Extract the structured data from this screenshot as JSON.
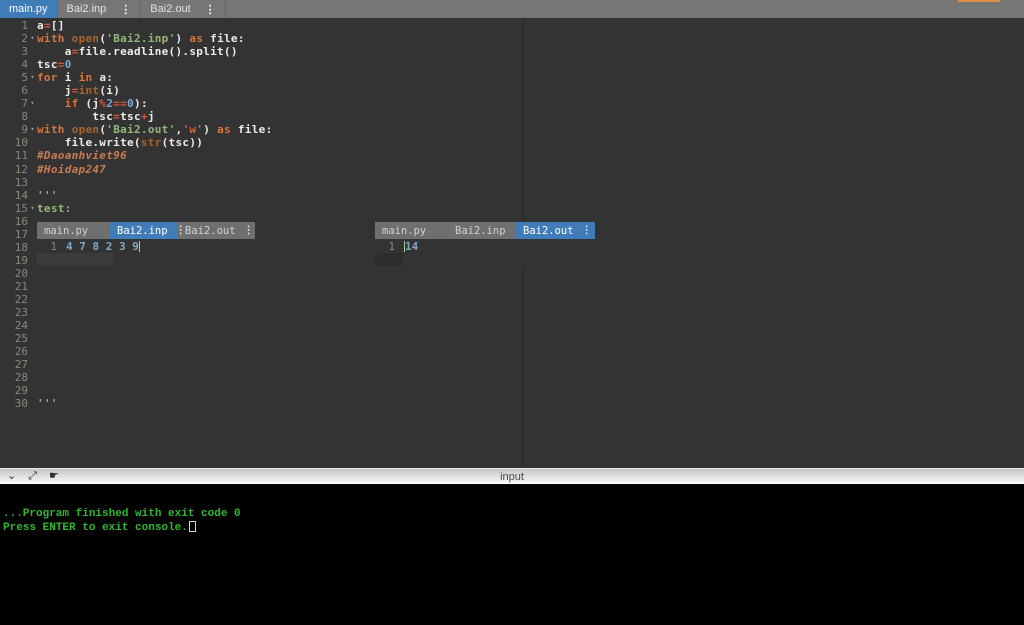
{
  "colors": {
    "tab_bar": "#767676",
    "active_tab": "#3f7cb8",
    "editor_bg": "#333333",
    "keyword": "#d9753c",
    "builtin": "#a8652f",
    "string": "#94b87c",
    "char_string": "#cc6644",
    "operator": "#d4553e",
    "number": "#7fa8c9",
    "comment": "#c87c50",
    "console_text": "#2fb92f"
  },
  "icons": {
    "menu_dots": "⋮",
    "collapse": "⌄",
    "resize": "⤢",
    "pointer": "☛",
    "fold_marker": "▾"
  },
  "top_tabs": [
    {
      "label": "main.py",
      "active": true
    },
    {
      "label": "Bai2.inp",
      "active": false
    },
    {
      "label": "Bai2.out",
      "active": false
    }
  ],
  "editor": {
    "fold_lines": [
      2,
      5,
      7,
      9,
      15
    ],
    "lines": [
      [
        [
          "a",
          "t"
        ],
        [
          "=",
          "o"
        ],
        [
          "[]",
          "t"
        ]
      ],
      [
        [
          "with",
          "k"
        ],
        [
          " ",
          "t"
        ],
        [
          "open",
          "f"
        ],
        [
          "(",
          "t"
        ],
        [
          "'Bai2.inp'",
          "s"
        ],
        [
          ") ",
          "t"
        ],
        [
          "as",
          "k"
        ],
        [
          " file:",
          "t"
        ]
      ],
      [
        [
          "    a",
          "t"
        ],
        [
          "=",
          "o"
        ],
        [
          "file.readline().split()",
          "t"
        ]
      ],
      [
        [
          "tsc",
          "t"
        ],
        [
          "=",
          "o"
        ],
        [
          "0",
          "n"
        ]
      ],
      [
        [
          "for",
          "k"
        ],
        [
          " i ",
          "t"
        ],
        [
          "in",
          "k"
        ],
        [
          " a:",
          "t"
        ]
      ],
      [
        [
          "    j",
          "t"
        ],
        [
          "=",
          "o"
        ],
        [
          "int",
          "f"
        ],
        [
          "(i)",
          "t"
        ]
      ],
      [
        [
          "    ",
          "t"
        ],
        [
          "if",
          "k"
        ],
        [
          " (j",
          "t"
        ],
        [
          "%",
          "o"
        ],
        [
          "2",
          "n"
        ],
        [
          "==",
          "o"
        ],
        [
          "0",
          "n"
        ],
        [
          "):",
          "t"
        ]
      ],
      [
        [
          "        tsc",
          "t"
        ],
        [
          "=",
          "o"
        ],
        [
          "tsc",
          "t"
        ],
        [
          "+",
          "o"
        ],
        [
          "j",
          "t"
        ]
      ],
      [
        [
          "with",
          "k"
        ],
        [
          " ",
          "t"
        ],
        [
          "open",
          "f"
        ],
        [
          "(",
          "t"
        ],
        [
          "'Bai2.out'",
          "s"
        ],
        [
          ",",
          "t"
        ],
        [
          "'w'",
          "w"
        ],
        [
          ") ",
          "t"
        ],
        [
          "as",
          "k"
        ],
        [
          " file:",
          "t"
        ]
      ],
      [
        [
          "    file.write(",
          "t"
        ],
        [
          "str",
          "f"
        ],
        [
          "(tsc))",
          "t"
        ]
      ],
      [
        [
          "#Daoanhviet96",
          "c"
        ]
      ],
      [
        [
          "#Hoidap247",
          "c"
        ]
      ],
      [],
      [
        [
          "'''",
          "s"
        ]
      ],
      [
        [
          "test:",
          "s"
        ]
      ],
      [],
      [],
      [],
      [],
      [],
      [],
      [],
      [],
      [],
      [],
      [],
      [],
      [],
      [],
      [
        [
          "'''",
          "s"
        ]
      ]
    ]
  },
  "panels": [
    {
      "tabs": [
        {
          "label": "main.py",
          "active": false
        },
        {
          "label": "Bai2.inp",
          "active": true
        },
        {
          "label": "Bai2.out",
          "active": false
        }
      ],
      "line_number": "1",
      "content": "4 7 8 2 3 9"
    },
    {
      "tabs": [
        {
          "label": "main.py",
          "active": false
        },
        {
          "label": "Bai2.inp",
          "active": false
        },
        {
          "label": "Bai2.out",
          "active": true
        }
      ],
      "line_number": "1",
      "content": "14"
    }
  ],
  "console": {
    "header": "input",
    "lines": [
      "...Program finished with exit code 0",
      "Press ENTER to exit console."
    ]
  }
}
